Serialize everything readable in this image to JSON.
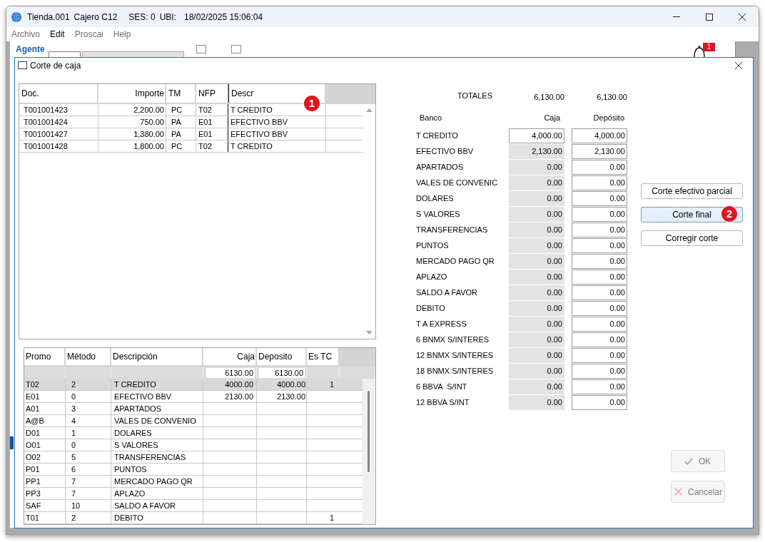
{
  "window": {
    "app_name": "Tienda.001",
    "cashier": "Cajero C12",
    "session": "SES: 0",
    "location_label": "UBI:",
    "timestamp": "18/02/2025 15:06:04"
  },
  "menu": [
    {
      "label": "Archivo",
      "disabled": true
    },
    {
      "label": "Edit",
      "disabled": false
    },
    {
      "label": "Proscai",
      "disabled": true
    },
    {
      "label": "Help",
      "disabled": true
    }
  ],
  "background_window": {
    "agent_label": "Agente",
    "checkboxes": [
      {
        "checked": false
      },
      {
        "checked": false
      }
    ],
    "notification_count": "1"
  },
  "dialog": {
    "title": "Corte de caja"
  },
  "documents_table": {
    "columns": [
      "Doc.",
      "Importe",
      "TM",
      "NFP",
      "Descr"
    ],
    "marker": "1",
    "rows": [
      {
        "doc": "T001001423",
        "amount": "2,200.00",
        "tm": "PC",
        "nfp": "T02",
        "description": "T CREDITO"
      },
      {
        "doc": "T001001424",
        "amount": "750.00",
        "tm": "PA",
        "nfp": "E01",
        "description": "EFECTIVO BBV"
      },
      {
        "doc": "T001001427",
        "amount": "1,380.00",
        "tm": "PA",
        "nfp": "E01",
        "description": "EFECTIVO BBV"
      },
      {
        "doc": "T001001428",
        "amount": "1,800.00",
        "tm": "PC",
        "nfp": "T02",
        "description": "T CREDITO"
      }
    ]
  },
  "methods_table": {
    "columns": [
      "Promo",
      "Método",
      "Descripción",
      "Caja",
      "Deposito",
      "Es TC"
    ],
    "totals": {
      "caja": "6130.00",
      "deposito": "6130.00"
    },
    "rows": [
      {
        "promo": "T02",
        "method": "2",
        "description": "T CREDITO",
        "caja": "4000.00",
        "deposito": "4000.00",
        "es_tc": "1",
        "selected": true
      },
      {
        "promo": "E01",
        "method": "0",
        "description": "EFECTIVO BBV",
        "caja": "2130.00",
        "deposito": "2130.00",
        "selected": false
      },
      {
        "promo": "A01",
        "method": "3",
        "description": "APARTADOS",
        "selected": false
      },
      {
        "promo": "A@B",
        "method": "4",
        "description": "VALES DE CONVENIO",
        "selected": false
      },
      {
        "promo": "D01",
        "method": "1",
        "description": "DOLARES",
        "selected": false
      },
      {
        "promo": "O01",
        "method": "0",
        "description": "S VALORES",
        "selected": false
      },
      {
        "promo": "O02",
        "method": "5",
        "description": "TRANSFERENCIAS",
        "selected": false
      },
      {
        "promo": "P01",
        "method": "6",
        "description": "PUNTOS",
        "selected": false
      },
      {
        "promo": "PP1",
        "method": "7",
        "description": "MERCADO PAGO QR",
        "selected": false
      },
      {
        "promo": "PP3",
        "method": "7",
        "description": "APLAZO",
        "selected": false
      },
      {
        "promo": "SAF",
        "method": "10",
        "description": "SALDO A FAVOR",
        "selected": false
      },
      {
        "promo": "T01",
        "method": "2",
        "description": "DEBITO",
        "es_tc": "1",
        "selected": false
      }
    ]
  },
  "bank_summary": {
    "totals_label": "TOTALES",
    "total_caja": "6,130.00",
    "total_deposito": "6,130.00",
    "columns": [
      "Banco",
      "Caja",
      "Depósito"
    ],
    "rows": [
      {
        "name": "T CREDITO",
        "caja": "4,000.00",
        "caja_editable": true,
        "deposito": "4,000.00"
      },
      {
        "name": "EFECTIVO BBV",
        "caja": "2,130.00",
        "caja_editable": false,
        "deposito": "2,130.00"
      },
      {
        "name": "APARTADOS",
        "caja": "0.00",
        "caja_editable": false,
        "deposito": "0.00"
      },
      {
        "name": "VALES DE CONVENIC",
        "caja": "0.00",
        "caja_editable": false,
        "deposito": "0.00"
      },
      {
        "name": "DOLARES",
        "caja": "0.00",
        "caja_editable": false,
        "deposito": "0.00"
      },
      {
        "name": "S VALORES",
        "caja": "0.00",
        "caja_editable": false,
        "deposito": "0.00"
      },
      {
        "name": "TRANSFERENCIAS",
        "caja": "0.00",
        "caja_editable": false,
        "deposito": "0.00"
      },
      {
        "name": "PUNTOS",
        "caja": "0.00",
        "caja_editable": false,
        "deposito": "0.00"
      },
      {
        "name": "MERCADO PAGO QR",
        "caja": "0.00",
        "caja_editable": false,
        "deposito": "0.00"
      },
      {
        "name": "APLAZO",
        "caja": "0.00",
        "caja_editable": false,
        "deposito": "0.00"
      },
      {
        "name": "SALDO A FAVOR",
        "caja": "0.00",
        "caja_editable": false,
        "deposito": "0.00"
      },
      {
        "name": "DEBITO",
        "caja": "0.00",
        "caja_editable": false,
        "deposito": "0.00"
      },
      {
        "name": "T A EXPRESS",
        "caja": "0.00",
        "caja_editable": false,
        "deposito": "0.00"
      },
      {
        "name": "6 BNMX S/INTERES",
        "caja": "0.00",
        "caja_editable": false,
        "deposito": "0.00"
      },
      {
        "name": "12 BNMX S/INTERES",
        "caja": "0.00",
        "caja_editable": false,
        "deposito": "0.00"
      },
      {
        "name": "18 BNMX S/INTERES",
        "caja": "0.00",
        "caja_editable": false,
        "deposito": "0.00"
      },
      {
        "name": "6 BBVA  S/INT",
        "caja": "0.00",
        "caja_editable": false,
        "deposito": "0.00"
      },
      {
        "name": "12 BBVA S/INT",
        "caja": "0.00",
        "caja_editable": false,
        "deposito": "0.00"
      }
    ]
  },
  "actions": [
    {
      "label": "Corte efectivo parcial",
      "focused": false
    },
    {
      "label": "Corte final",
      "focused": true,
      "marker": "2"
    },
    {
      "label": "Corregir corte",
      "focused": false
    }
  ],
  "dialog_buttons": [
    {
      "kind": "ok",
      "label": "OK",
      "disabled": true
    },
    {
      "kind": "cancel",
      "label": "Cancelar",
      "disabled": true
    }
  ]
}
